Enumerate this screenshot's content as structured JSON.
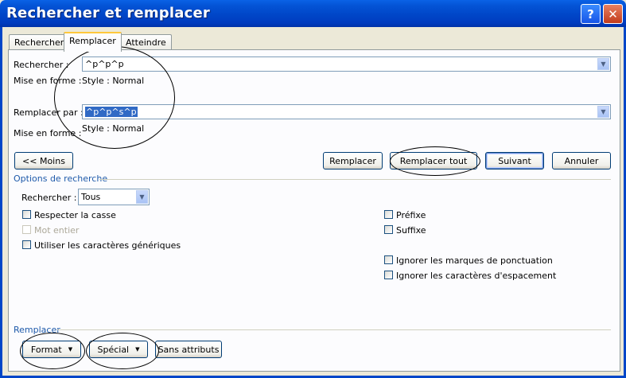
{
  "window": {
    "title": "Rechercher et remplacer",
    "help_icon": "?",
    "close_icon": "✕"
  },
  "tabs": [
    "Rechercher",
    "Remplacer",
    "Atteindre"
  ],
  "find": {
    "label": "Rechercher :",
    "value": "^p^p^p",
    "format_label": "Mise en forme :",
    "format_value": "Style : Normal"
  },
  "replace": {
    "label": "Remplacer par :",
    "value": "^p^p^s^p",
    "format_label": "Mise en forme :",
    "format_value": "Style : Normal"
  },
  "buttons": {
    "less": "<< Moins",
    "replace": "Remplacer",
    "replace_all": "Remplacer tout",
    "next": "Suivant",
    "cancel": "Annuler"
  },
  "options": {
    "title": "Options de recherche",
    "search_label": "Rechercher :",
    "search_value": "Tous",
    "match_case": "Respecter la casse",
    "whole_word": "Mot entier",
    "wildcards": "Utiliser les caractères génériques",
    "prefix": "Préfixe",
    "suffix": "Suffixe",
    "ignore_punct": "Ignorer les marques de ponctuation",
    "ignore_space": "Ignorer les caractères d'espacement"
  },
  "replace_section": {
    "title": "Remplacer",
    "format": "Format",
    "special": "Spécial",
    "no_format": "Sans attributs"
  }
}
